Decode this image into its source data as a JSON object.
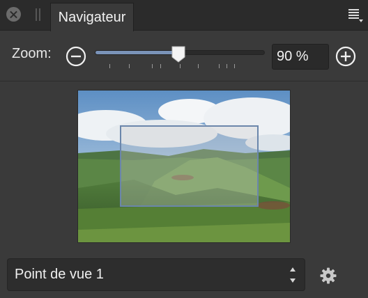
{
  "panel": {
    "tab_label": "Navigateur",
    "close_icon": "close-icon",
    "menu_icon": "hamburger-menu-icon"
  },
  "zoom": {
    "label": "Zoom:",
    "value_text": "90 %",
    "level_fraction": 0.5,
    "zoom_out_icon": "zoom-out-minus-circle-icon",
    "zoom_in_icon": "zoom-in-plus-circle-icon"
  },
  "thumbnail": {
    "description_icon": "landscape-preview-image",
    "viewport_color": "#6b86ab"
  },
  "view_selector": {
    "selected": "Point de vue 1",
    "settings_icon": "gear-icon"
  },
  "colors": {
    "accent": "#7a93b8",
    "panel_bg": "#3a3a3a",
    "header_bg": "#2b2b2b"
  }
}
